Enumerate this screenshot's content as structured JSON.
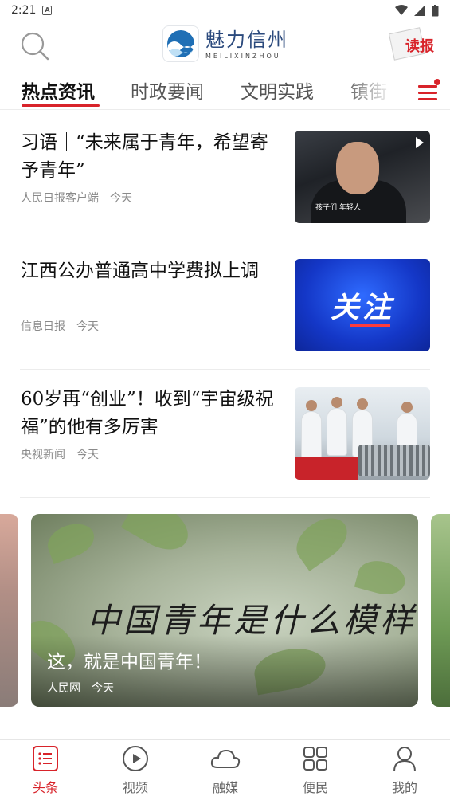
{
  "status_bar": {
    "time": "2:21"
  },
  "header": {
    "logo_cn": "魅力信州",
    "logo_en": "MEILIXINZHOU",
    "read_label": "读报"
  },
  "tabs": [
    {
      "label": "热点资讯",
      "active": true
    },
    {
      "label": "时政要闻"
    },
    {
      "label": "文明实践"
    },
    {
      "label": "镇街"
    }
  ],
  "news": [
    {
      "title": "习语｜“未来属于青年，希望寄予青年”",
      "source": "人民日报客户端",
      "time": "今天",
      "thumb_caption": "孩子们 年轻人"
    },
    {
      "title": "江西公办普通高中学费拟上调",
      "source": "信息日报",
      "time": "今天",
      "thumb_word": "关注"
    },
    {
      "title": "60岁再“创业”！收到“宇宙级祝福”的他有多厉害",
      "source": "央视新闻",
      "time": "今天"
    }
  ],
  "carousel": {
    "heading": "中国青年是什么模样？",
    "title": "这，就是中国青年！",
    "source": "人民网",
    "time": "今天"
  },
  "bottom_nav": [
    {
      "label": "头条",
      "icon": "headlines-icon",
      "active": true
    },
    {
      "label": "视频",
      "icon": "play-icon"
    },
    {
      "label": "融媒",
      "icon": "cloud-icon"
    },
    {
      "label": "便民",
      "icon": "grid-icon"
    },
    {
      "label": "我的",
      "icon": "user-icon"
    }
  ],
  "colors": {
    "accent": "#d8232a",
    "text": "#111111",
    "meta": "#8a8a8a"
  }
}
